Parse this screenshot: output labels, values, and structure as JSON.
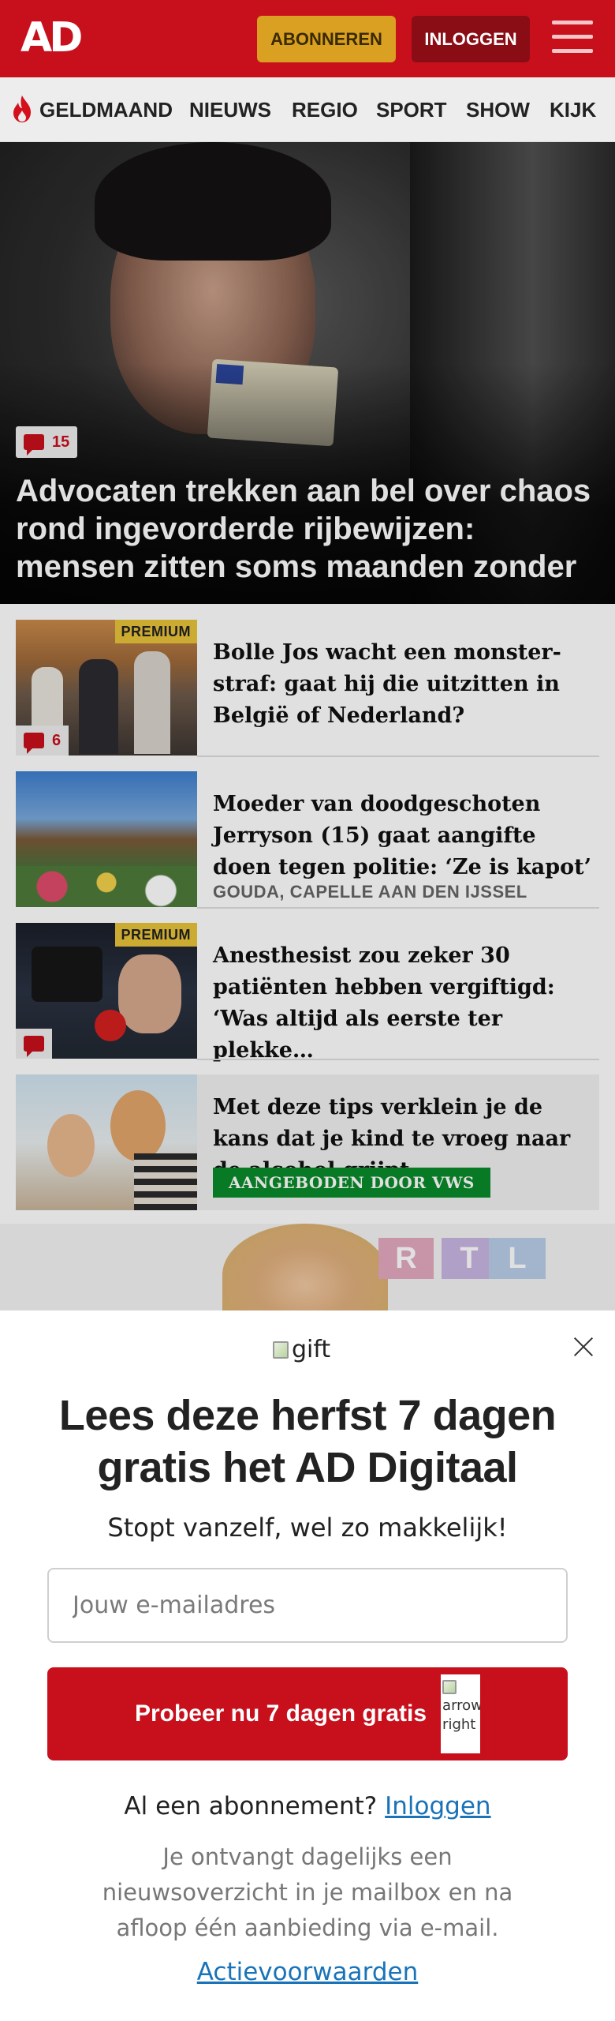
{
  "header": {
    "logo": "AD",
    "subscribe_label": "ABONNEREN",
    "login_label": "INLOGGEN",
    "menu_icon": "hamburger-icon",
    "colors": {
      "brand": "#c8101d",
      "subscribe": "#d9a021",
      "login": "#8a0c15"
    }
  },
  "nav": {
    "items": [
      {
        "label": "GELDMAAND",
        "icon": "flame-icon"
      },
      {
        "label": "NIEUWS"
      },
      {
        "label": "REGIO"
      },
      {
        "label": "SPORT"
      },
      {
        "label": "SHOW"
      },
      {
        "label": "KIJK"
      }
    ]
  },
  "hero": {
    "comment_count": "15",
    "title": "Advocaten trekken aan bel over chaos rond ingevorderde rijbewijzen: mensen zitten soms maanden zonder"
  },
  "articles": [
    {
      "title": "Bolle Jos wacht een monster-straf: gaat hij die uitzitten in België of Nederland?",
      "badge": "PREMIUM",
      "comment_count": "6"
    },
    {
      "title": "Moeder van doodgeschoten Jerryson (15) gaat aangifte doen tegen politie: ‘Ze is kapot’",
      "location": "GOUDA, CAPELLE AAN DEN IJSSEL"
    },
    {
      "title": "Anesthesist zou zeker 30 patiënten hebben vergiftigd: ‘Was altijd als eerste ter plekke…",
      "badge": "PREMIUM",
      "comment_count": ""
    },
    {
      "title": "Met deze tips verklein je de kans dat je kind te vroeg naar de alcohol grijpt",
      "sponsor": "AANGEBODEN DOOR VWS"
    }
  ],
  "ad": {
    "letters": [
      "R",
      "T",
      "L"
    ]
  },
  "modal": {
    "gift_alt": "gift",
    "title": "Lees deze herfst 7 dagen gratis het AD Digitaal",
    "subtitle": "Stopt vanzelf, wel zo makkelijk!",
    "email_placeholder": "Jouw e-mailadres",
    "cta_label": "Probeer nu 7 dagen gratis",
    "cta_icon_alt": "arrow-right",
    "have_subscription": "Al een abonnement?",
    "login_link": "Inloggen",
    "info": "Je ontvangt dagelijks een nieuwsoverzicht in je mailbox en na afloop één aanbieding via e-mail.",
    "terms_link": "Actievoorwaarden"
  }
}
